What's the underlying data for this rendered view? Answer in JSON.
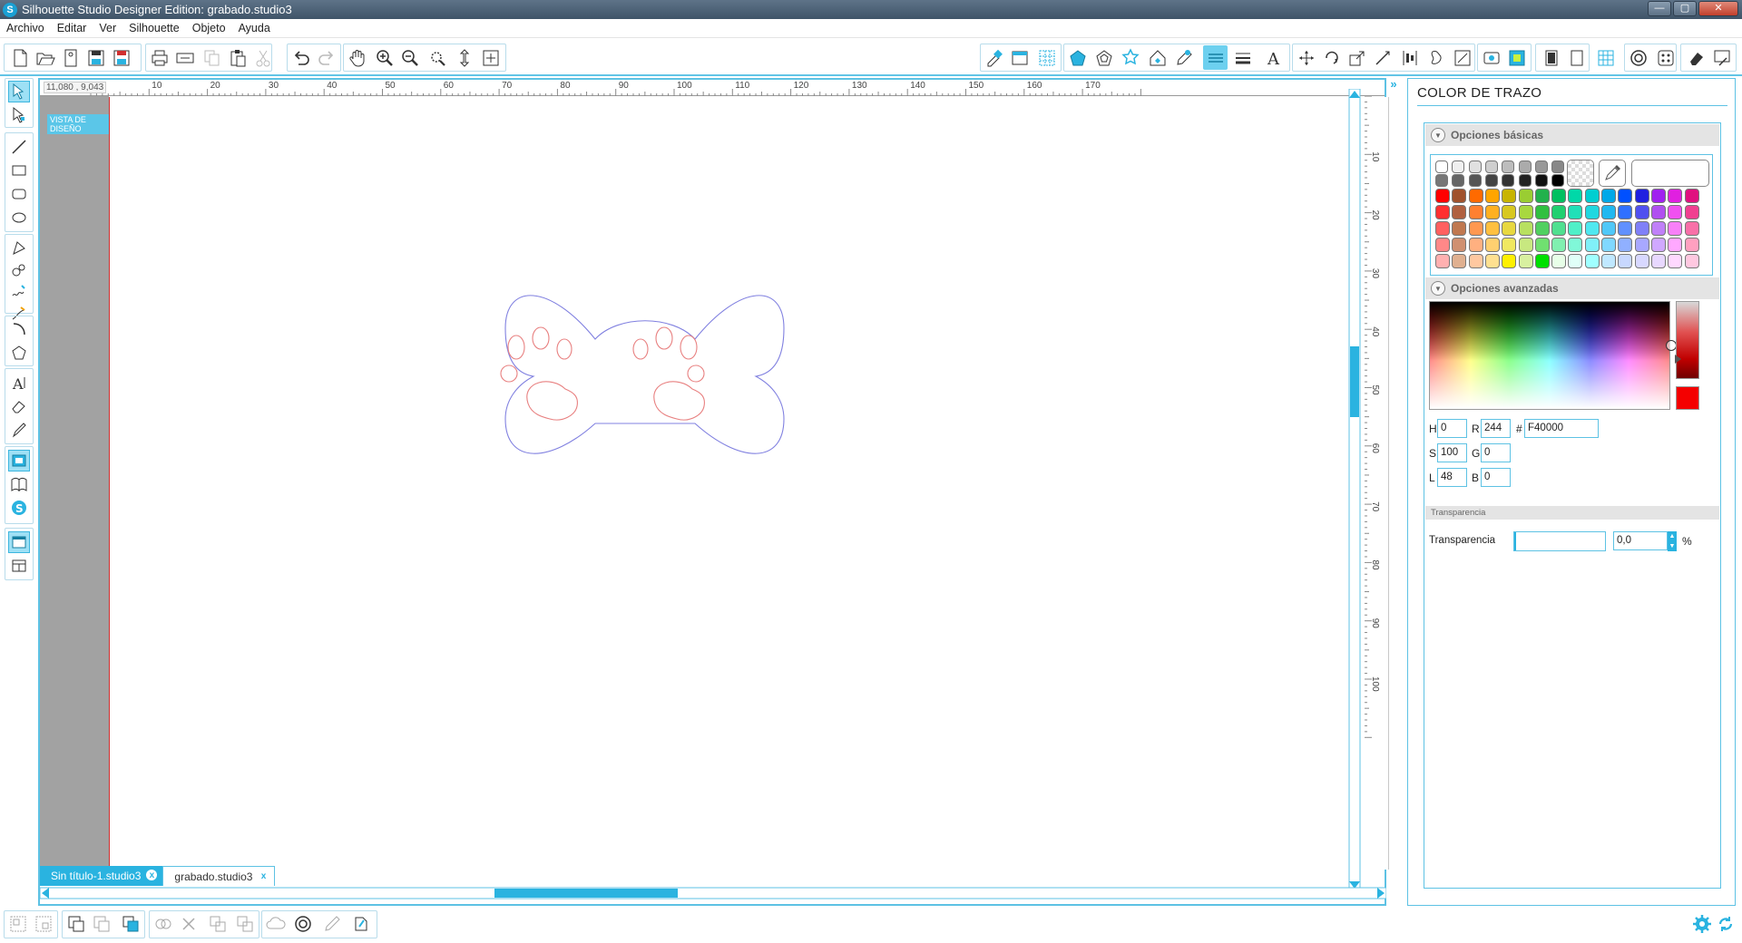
{
  "window": {
    "title": "Silhouette Studio Designer Edition: grabado.studio3"
  },
  "menu": {
    "items": [
      "Archivo",
      "Editar",
      "Ver",
      "Silhouette",
      "Objeto",
      "Ayuda"
    ]
  },
  "canvas": {
    "coordinates": "11,080 , 9,043",
    "view_tag": "VISTA DE DISEÑO",
    "h_ruler_labels": [
      "0",
      "10",
      "20",
      "30",
      "40",
      "50",
      "60",
      "70",
      "80",
      "90",
      "100",
      "110",
      "120",
      "130",
      "140",
      "150",
      "160",
      "170"
    ],
    "v_ruler_labels": [
      "0",
      "10",
      "20",
      "30",
      "40",
      "50",
      "60",
      "70",
      "80",
      "90",
      "100"
    ]
  },
  "tabs": [
    {
      "label": "Sin título-1.studio3",
      "active": true,
      "close": "x"
    },
    {
      "label": "grabado.studio3",
      "active": false,
      "close": "x"
    }
  ],
  "panel": {
    "title": "COLOR DE TRAZO",
    "basic_section": "Opciones básicas",
    "advanced_section": "Opciones avanzadas",
    "hsl": {
      "h_label": "H",
      "h": "0",
      "s_label": "S",
      "s": "100",
      "l_label": "L",
      "l": "48"
    },
    "rgb": {
      "r_label": "R",
      "r": "244",
      "g_label": "G",
      "g": "0",
      "b_label": "B",
      "b": "0"
    },
    "hex_label": "#",
    "hex": "F40000",
    "current_color": "#F40000",
    "transparency_header": "Transparencia",
    "transparency_label": "Transparencia",
    "transparency_value": "0,0",
    "transparency_unit": "%"
  },
  "colors": {
    "accent": "#2AB3E0",
    "bone_stroke": "#8080E0",
    "paw_stroke": "#E88080",
    "swatch_rows": [
      [
        "#FFFFFF",
        "#F0F0F0",
        "#E0E0E0",
        "#CFCFCF",
        "#BDBDBD",
        "#ABABAB",
        "#999999",
        "#888888"
      ],
      [
        "#777777",
        "#666666",
        "#555555",
        "#444444",
        "#333333",
        "#222222",
        "#111111",
        "#000000"
      ],
      [
        "#FF0000",
        "#A0522D",
        "#FF6A00",
        "#FFA500",
        "#C8B400",
        "#9ACD32",
        "#22B14C",
        "#00C060",
        "#00D8A8",
        "#00CED1",
        "#00A8E8",
        "#0050FF",
        "#2020E0",
        "#A020F0",
        "#E020E0",
        "#E0107F"
      ],
      [
        "#FF3030",
        "#B06040",
        "#FF8030",
        "#FFB020",
        "#D8C820",
        "#A8D840",
        "#30C040",
        "#20D070",
        "#20E0B8",
        "#20D8E0",
        "#20B8F0",
        "#3070FF",
        "#5050F0",
        "#B050F0",
        "#F050F0",
        "#F04090"
      ],
      [
        "#FF6060",
        "#C07850",
        "#FF9850",
        "#FFC040",
        "#E8D840",
        "#B8E060",
        "#50D060",
        "#50E090",
        "#50F0C8",
        "#50E8F0",
        "#50C8F8",
        "#6090FF",
        "#8080F8",
        "#C080F8",
        "#F880F8",
        "#F870A8"
      ],
      [
        "#FF8888",
        "#D09070",
        "#FFB080",
        "#FFD070",
        "#F0E860",
        "#C8E880",
        "#70E070",
        "#80F0B0",
        "#80F8D8",
        "#80F0F8",
        "#80D8FF",
        "#90B0FF",
        "#A8A8FF",
        "#D0A8FF",
        "#FFA8FF",
        "#FFA0C0"
      ],
      [
        "#FFB0B0",
        "#E0B090",
        "#FFC8A0",
        "#FFE090",
        "#FFF000",
        "#D8F0A0",
        "#00E000",
        "#E8FFE8",
        "#E0FFF8",
        "#A0FFFF",
        "#C0E8FF",
        "#C8D8FF",
        "#D8D8FF",
        "#E8D8FF",
        "#FFD8FF",
        "#FFC8E0"
      ]
    ]
  },
  "icons": {
    "toolbar": [
      "new-icon",
      "open-icon",
      "template-icon",
      "save-icon",
      "save-library-icon",
      "print-icon",
      "send-icon",
      "copy-icon",
      "paste-icon",
      "cut-icon",
      "undo-icon",
      "redo-icon",
      "hand-icon",
      "zoom-in-icon",
      "zoom-out-icon",
      "zoom-select-icon",
      "drag-zoom-icon",
      "fit-page-icon",
      "page-settings-icon",
      "grid-icon",
      "fill-color-icon",
      "gradient-icon",
      "fill-pattern-icon",
      "line-color-icon",
      "line-style-icon",
      "text-style-icon",
      "replicate-icon",
      "offset-icon",
      "trace-icon",
      "sketch-icon",
      "store-icon"
    ]
  }
}
